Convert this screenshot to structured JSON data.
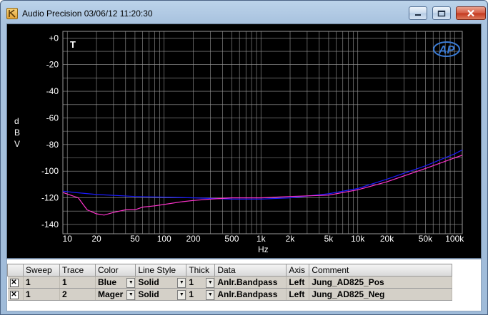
{
  "window": {
    "title": "Audio Precision  03/06/12 11:20:30",
    "controls": {
      "minimize": "minimize-icon",
      "maximize": "maximize-icon",
      "close": "close-icon"
    }
  },
  "chart_data": {
    "type": "line",
    "title": "",
    "xlabel": "Hz",
    "ylabel": "dBV",
    "x_scale": "log",
    "xlim": [
      9,
      120000
    ],
    "ylim": [
      -147,
      5
    ],
    "grid": true,
    "marker_text": "T",
    "logo": "AP",
    "x_ticks": [
      {
        "value": 10,
        "label": "10"
      },
      {
        "value": 20,
        "label": "20"
      },
      {
        "value": 50,
        "label": "50"
      },
      {
        "value": 100,
        "label": "100"
      },
      {
        "value": 200,
        "label": "200"
      },
      {
        "value": 500,
        "label": "500"
      },
      {
        "value": 1000,
        "label": "1k"
      },
      {
        "value": 2000,
        "label": "2k"
      },
      {
        "value": 5000,
        "label": "5k"
      },
      {
        "value": 10000,
        "label": "10k"
      },
      {
        "value": 20000,
        "label": "20k"
      },
      {
        "value": 50000,
        "label": "50k"
      },
      {
        "value": 100000,
        "label": "100k"
      }
    ],
    "y_ticks": [
      {
        "value": 0,
        "label": "+0"
      },
      {
        "value": -20,
        "label": "-20"
      },
      {
        "value": -40,
        "label": "-40"
      },
      {
        "value": -60,
        "label": "-60"
      },
      {
        "value": -80,
        "label": "-80"
      },
      {
        "value": -100,
        "label": "-100"
      },
      {
        "value": -120,
        "label": "-120"
      },
      {
        "value": -140,
        "label": "-140"
      }
    ],
    "series": [
      {
        "color": "#1a1aff",
        "points": [
          [
            9,
            -115
          ],
          [
            12,
            -116
          ],
          [
            20,
            -117.5
          ],
          [
            50,
            -119
          ],
          [
            100,
            -119.5
          ],
          [
            200,
            -120
          ],
          [
            500,
            -121
          ],
          [
            1000,
            -121
          ],
          [
            2000,
            -120
          ],
          [
            5000,
            -117
          ],
          [
            10000,
            -113
          ],
          [
            20000,
            -106
          ],
          [
            50000,
            -96
          ],
          [
            100000,
            -87
          ],
          [
            120000,
            -84
          ]
        ]
      },
      {
        "color": "#ff33cc",
        "points": [
          [
            9,
            -116
          ],
          [
            13,
            -120
          ],
          [
            16,
            -129
          ],
          [
            20,
            -132
          ],
          [
            24,
            -133
          ],
          [
            30,
            -131
          ],
          [
            40,
            -129
          ],
          [
            50,
            -129
          ],
          [
            60,
            -127
          ],
          [
            80,
            -126
          ],
          [
            100,
            -125
          ],
          [
            150,
            -123
          ],
          [
            200,
            -122
          ],
          [
            300,
            -121
          ],
          [
            500,
            -120
          ],
          [
            1000,
            -120
          ],
          [
            2000,
            -119
          ],
          [
            5000,
            -118
          ],
          [
            10000,
            -114
          ],
          [
            20000,
            -108
          ],
          [
            50000,
            -98
          ],
          [
            100000,
            -90
          ],
          [
            120000,
            -88
          ]
        ]
      }
    ]
  },
  "trace_table": {
    "columns": [
      "",
      "Sweep",
      "Trace",
      "Color",
      "Line Style",
      "Thick",
      "Data",
      "Axis",
      "Comment"
    ],
    "rows": [
      {
        "check": "✕",
        "sweep": "1",
        "trace": "1",
        "color": "Blue",
        "line_style": "Solid",
        "thick": "1",
        "data": "Anlr.Bandpass",
        "axis": "Left",
        "comment": "Jung_AD825_Pos"
      },
      {
        "check": "✕",
        "sweep": "1",
        "trace": "2",
        "color": "Mager",
        "line_style": "Solid",
        "thick": "1",
        "data": "Anlr.Bandpass",
        "axis": "Left",
        "comment": "Jung_AD825_Neg"
      }
    ]
  }
}
